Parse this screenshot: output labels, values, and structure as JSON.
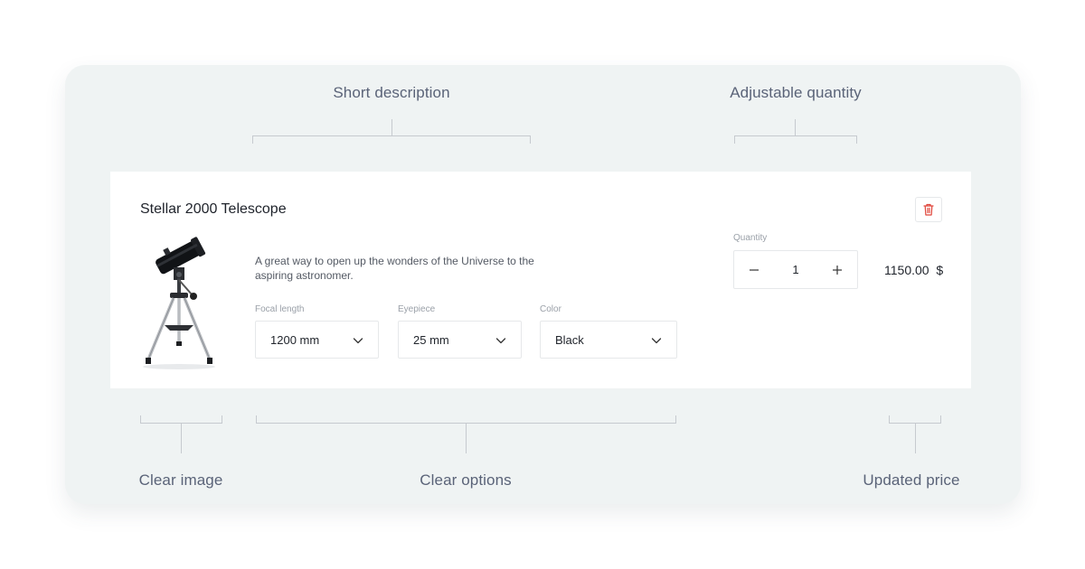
{
  "annotations": {
    "short_description": "Short description",
    "adjustable_quantity": "Adjustable quantity",
    "clear_image": "Clear image",
    "clear_options": "Clear options",
    "updated_price": "Updated price"
  },
  "product": {
    "title": "Stellar 2000 Telescope",
    "description": "A great way to open up the wonders of the Universe to the aspiring astronomer.",
    "image_icon": "telescope",
    "options": [
      {
        "label": "Focal length",
        "value": "1200 mm"
      },
      {
        "label": "Eyepiece",
        "value": "25 mm"
      },
      {
        "label": "Color",
        "value": "Black"
      }
    ],
    "quantity_label": "Quantity",
    "quantity": "1",
    "price": "1150.00  $"
  },
  "colors": {
    "panel_bg": "#eff3f3",
    "card_bg": "#ffffff",
    "delete_icon": "#e0453a",
    "annotation_text": "#5a6378",
    "bracket": "#c6cacf"
  }
}
